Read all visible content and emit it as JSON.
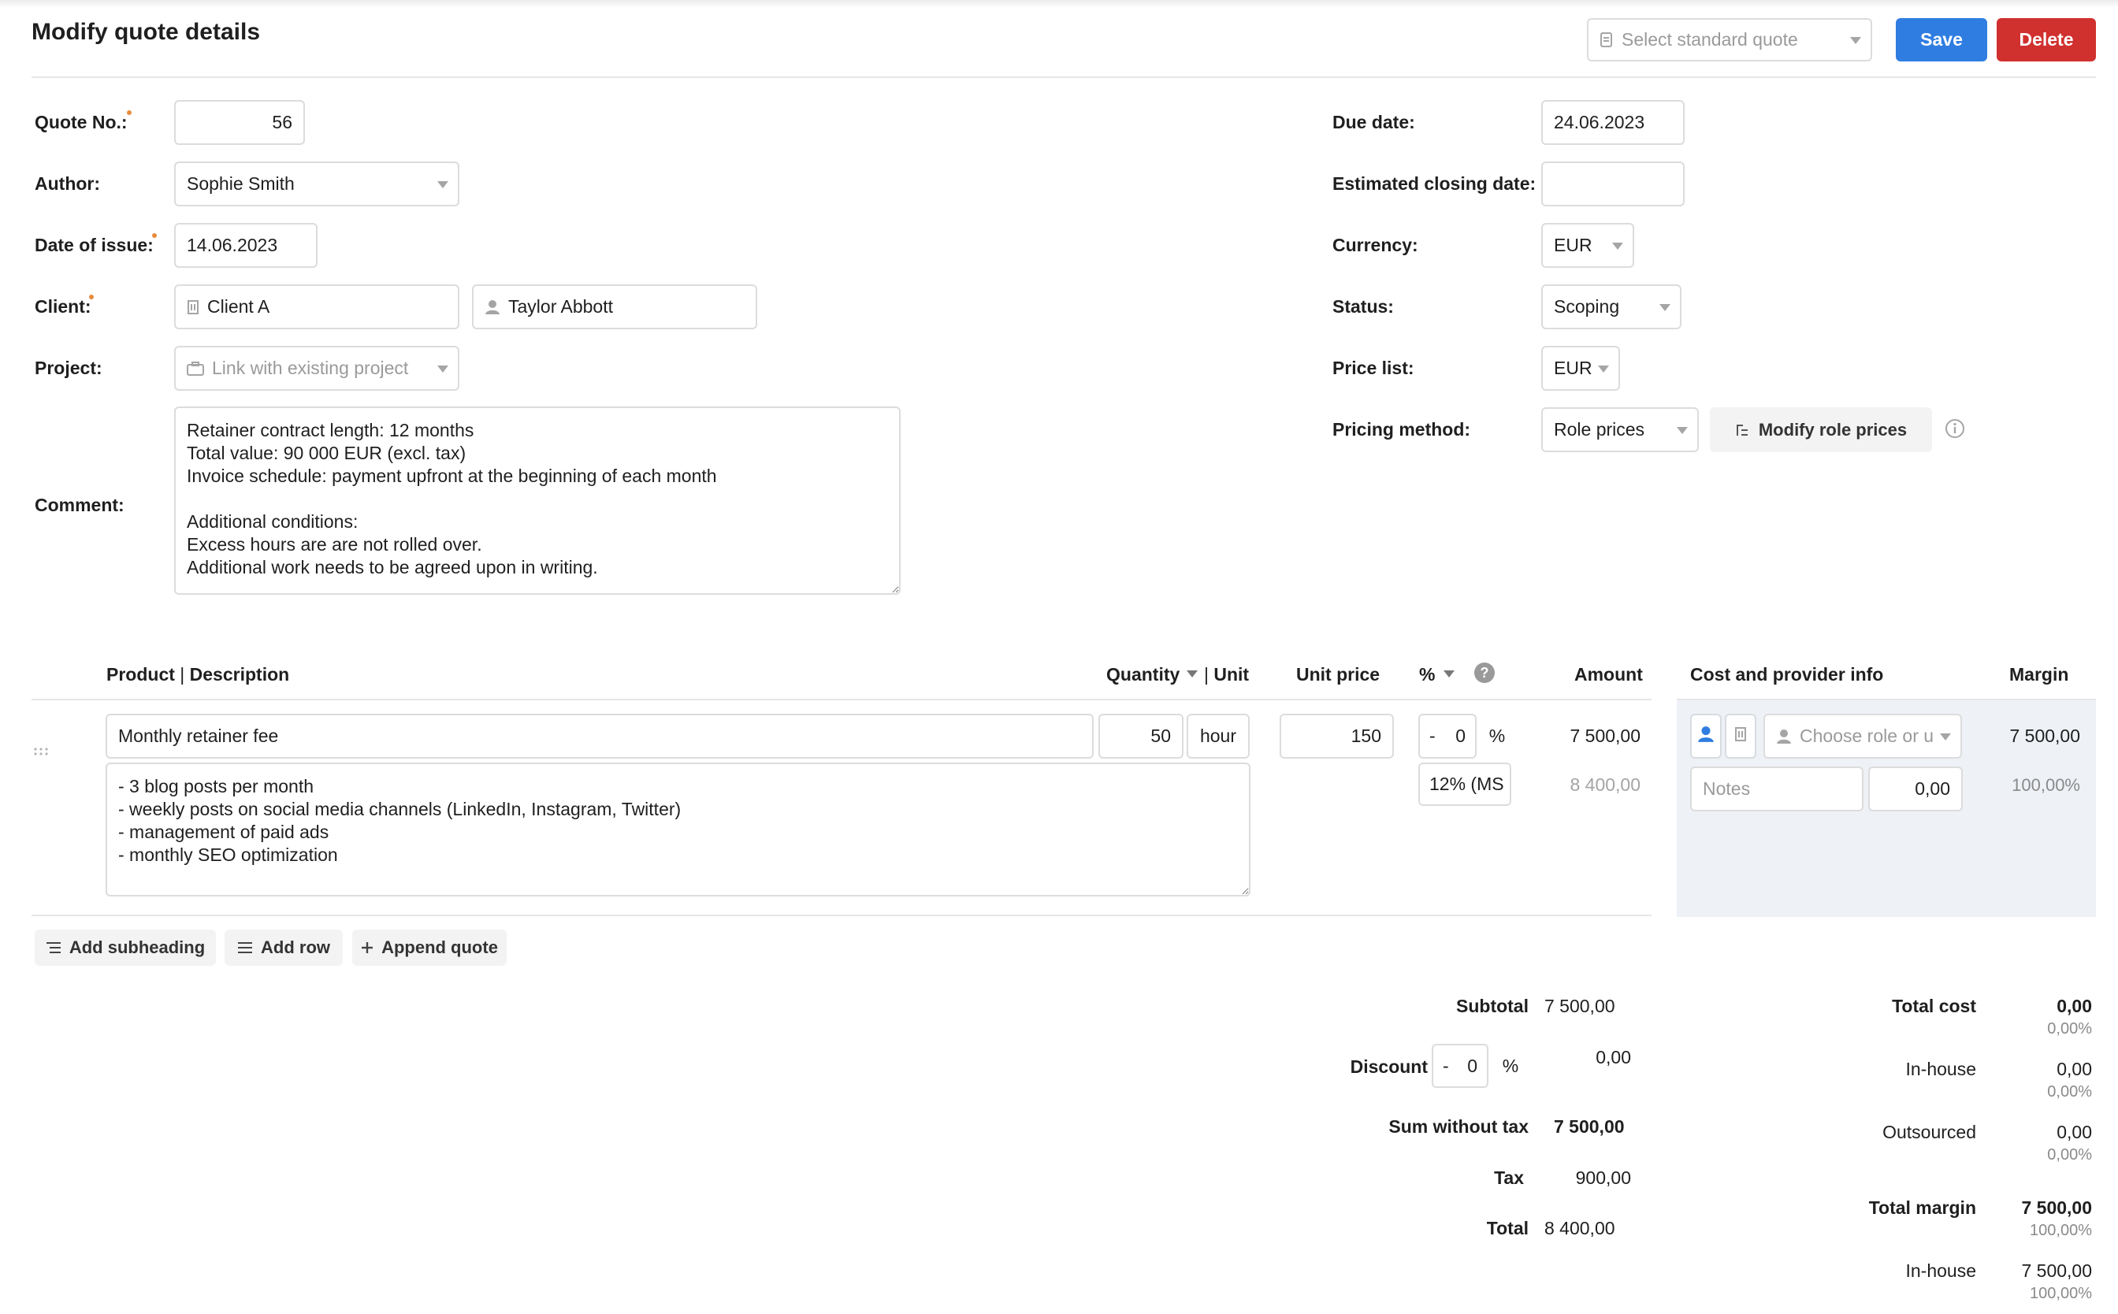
{
  "header": {
    "title": "Modify quote details",
    "standard_quote_placeholder": "Select standard quote",
    "save_label": "Save",
    "delete_label": "Delete"
  },
  "form_left": {
    "quote_no_label": "Quote No.:",
    "quote_no": "56",
    "author_label": "Author:",
    "author": "Sophie Smith",
    "date_issue_label": "Date of issue:",
    "date_issue": "14.06.2023",
    "client_label": "Client:",
    "client": "Client A",
    "contact": "Taylor Abbott",
    "project_label": "Project:",
    "project_placeholder": "Link with existing project",
    "comment_label": "Comment:",
    "comment": "Retainer contract length: 12 months\nTotal value: 90 000 EUR (excl. tax)\nInvoice schedule: payment upfront at the beginning of each month\n\nAdditional conditions:\nExcess hours are are not rolled over.\nAdditional work needs to be agreed upon in writing."
  },
  "form_right": {
    "due_date_label": "Due date:",
    "due_date": "24.06.2023",
    "closing_date_label": "Estimated closing date:",
    "closing_date": "",
    "currency_label": "Currency:",
    "currency": "EUR",
    "status_label": "Status:",
    "status": "Scoping",
    "price_list_label": "Price list:",
    "price_list": "EUR",
    "pricing_method_label": "Pricing method:",
    "pricing_method": "Role prices",
    "modify_role_prices_label": "Modify role prices"
  },
  "table": {
    "headers": {
      "product": "Product",
      "description": "Description",
      "quantity": "Quantity",
      "unit": "Unit",
      "unit_price": "Unit price",
      "percent": "%",
      "amount": "Amount",
      "cost_info": "Cost and provider info",
      "margin": "Margin"
    },
    "rows": [
      {
        "product": "Monthly retainer fee",
        "description": "- 3 blog posts per month\n- weekly posts on social media channels (LinkedIn, Instagram, Twitter)\n- management of paid ads\n- monthly SEO optimization",
        "quantity": "50",
        "unit": "hour",
        "unit_price": "150",
        "discount_sign": "-",
        "discount": "0",
        "discount_unit": "%",
        "tax": "12% (MS",
        "amount": "7 500,00",
        "amount_with_tax": "8 400,00",
        "role_placeholder": "Choose role or u",
        "notes_placeholder": "Notes",
        "cost": "0,00",
        "margin": "7 500,00",
        "margin_pct": "100,00%"
      }
    ]
  },
  "actions": {
    "add_subheading": "Add subheading",
    "add_row": "Add row",
    "append_quote": "Append quote"
  },
  "totals": {
    "subtotal_label": "Subtotal",
    "subtotal": "7 500,00",
    "discount_label": "Discount",
    "discount_sign": "-",
    "discount_value": "0",
    "discount_unit": "%",
    "discount_amount": "0,00",
    "sum_wo_tax_label": "Sum without tax",
    "sum_wo_tax": "7 500,00",
    "tax_label": "Tax",
    "tax": "900,00",
    "total_label": "Total",
    "total": "8 400,00"
  },
  "cost_summary": {
    "total_cost_label": "Total cost",
    "total_cost": "0,00",
    "total_cost_pct": "0,00%",
    "inhouse_label": "In-house",
    "inhouse": "0,00",
    "inhouse_pct": "0,00%",
    "outsourced_label": "Outsourced",
    "outsourced": "0,00",
    "outsourced_pct": "0,00%",
    "total_margin_label": "Total margin",
    "total_margin": "7 500,00",
    "total_margin_pct": "100,00%",
    "margin_inhouse_label": "In-house",
    "margin_inhouse": "7 500,00",
    "margin_inhouse_pct": "100,00%"
  },
  "colors": {
    "save": "#2f7de1",
    "delete": "#d0302e",
    "required_dot": "#e98b3c",
    "cost_panel": "#eef1f6"
  },
  "icons": [
    "document-icon",
    "building-icon",
    "person-icon",
    "briefcase-icon",
    "role-prices-icon",
    "info-icon",
    "help-icon",
    "drag-handle-icon",
    "subheading-icon",
    "rows-icon",
    "plus-icon",
    "sort-caret-icon",
    "resize-handle-icon"
  ]
}
